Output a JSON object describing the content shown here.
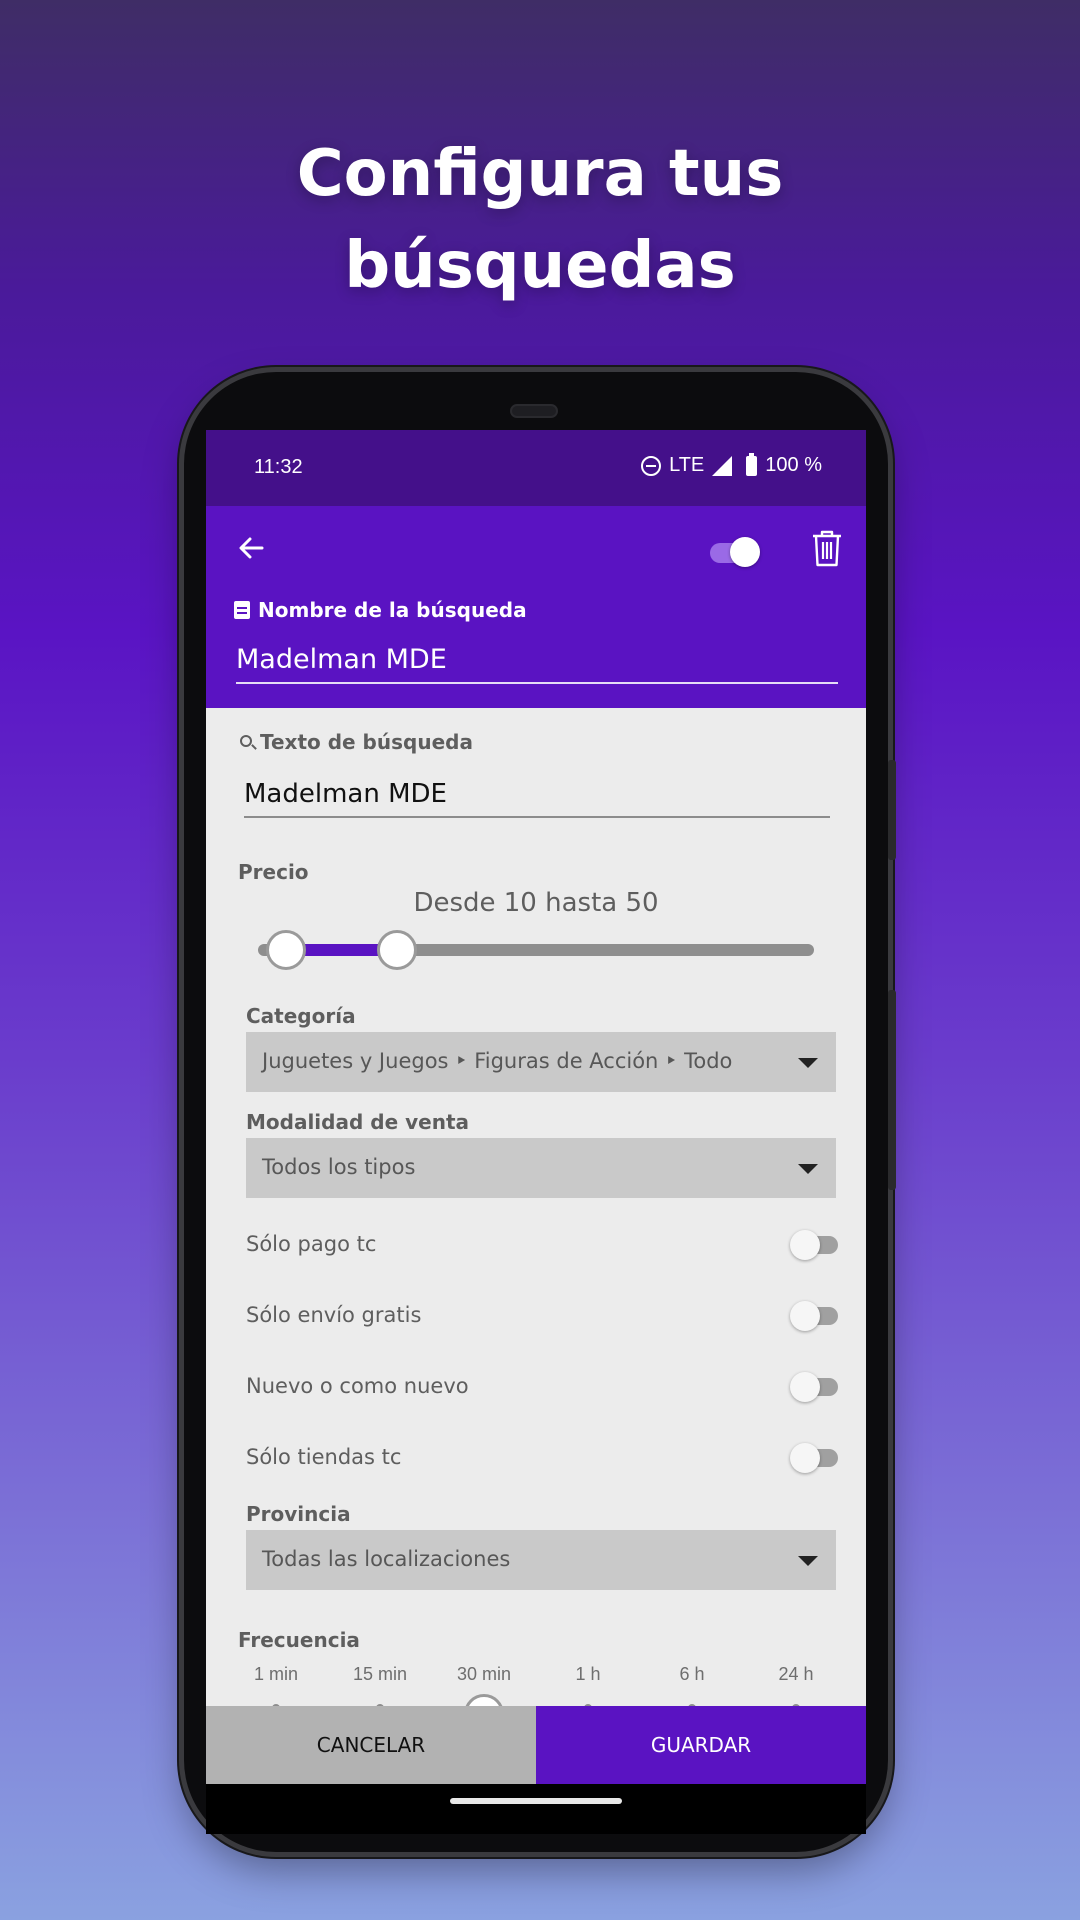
{
  "headline": {
    "line1": "Configura tus",
    "line2": "búsquedas"
  },
  "status_bar": {
    "time": "11:32",
    "network": "LTE",
    "battery": "100 %"
  },
  "app_bar": {
    "enabled_toggle": true,
    "name_label": "Nombre de la búsqueda",
    "name_value": "Madelman MDE"
  },
  "form": {
    "search_label": "Texto de búsqueda",
    "search_value": "Madelman MDE",
    "price": {
      "label": "Precio",
      "range_text": "Desde 10 hasta 50",
      "min": 10,
      "max": 50
    },
    "category": {
      "label": "Categoría",
      "value": "Juguetes y Juegos ‣ Figuras de Acción ‣ Todo"
    },
    "sale_mode": {
      "label": "Modalidad de venta",
      "value": "Todos los tipos"
    },
    "switches": [
      {
        "label": "Sólo pago tc",
        "on": false
      },
      {
        "label": "Sólo envío gratis",
        "on": false
      },
      {
        "label": "Nuevo o como nuevo",
        "on": false
      },
      {
        "label": "Sólo tiendas tc",
        "on": false
      }
    ],
    "province": {
      "label": "Provincia",
      "value": "Todas las localizaciones"
    },
    "frequency": {
      "label": "Frecuencia",
      "options": [
        "1 min",
        "15 min",
        "30 min",
        "1 h",
        "6 h",
        "24 h"
      ],
      "selected": "30 min"
    }
  },
  "buttons": {
    "cancel": "CANCELAR",
    "save": "GUARDAR"
  },
  "colors": {
    "primary": "#5a13c2",
    "status_bar": "#44108a",
    "screen_bg": "#ececec"
  },
  "icons": [
    "back-arrow-icon",
    "trash-icon",
    "document-icon",
    "search-icon",
    "dnd-icon",
    "signal-icon",
    "battery-icon"
  ]
}
